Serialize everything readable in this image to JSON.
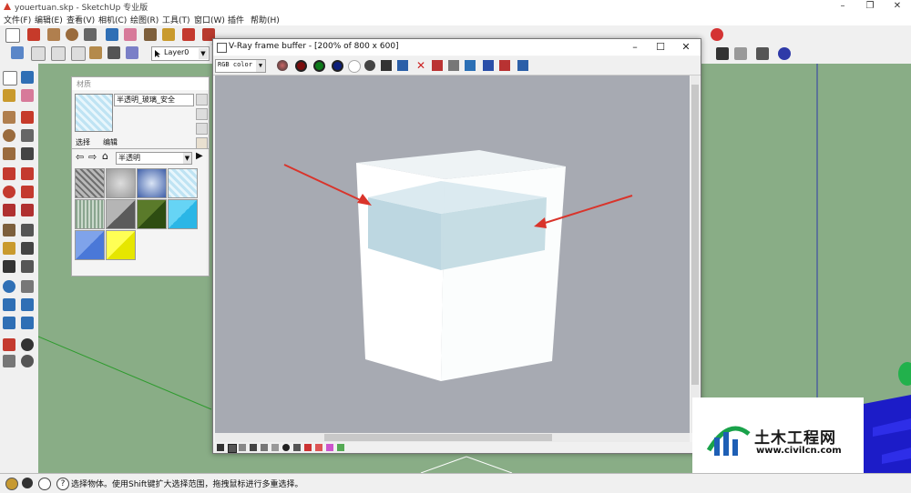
{
  "app": {
    "window_title": "youertuan.skp - SketchUp 专业版"
  },
  "menu": {
    "items": [
      "文件(F)",
      "编辑(E)",
      "查看(V)",
      "相机(C)",
      "绘图(R)",
      "工具(T)",
      "窗口(W)",
      "插件",
      "帮助(H)"
    ]
  },
  "layers": {
    "current": "Layer0"
  },
  "materials_panel": {
    "title": "材质",
    "material_name": "半透明_玻璃_安全",
    "tabs": [
      "选择",
      "编辑"
    ],
    "collection": "半透明"
  },
  "vray_window": {
    "title": "V-Ray frame buffer - [200% of 800 x 600]",
    "channel": "RGB color"
  },
  "status": {
    "text": "选择物体。使用Shift键扩大选择范围，拖拽鼠标进行多重选择。"
  },
  "watermark": {
    "title": "土木工程网",
    "url": "www.civilcn.com"
  },
  "colors": {
    "viewport_green": "#89ad86",
    "render_bg": "#a7aab2",
    "arrow_red": "#d9342b",
    "glass_band": "#b9d5df"
  }
}
